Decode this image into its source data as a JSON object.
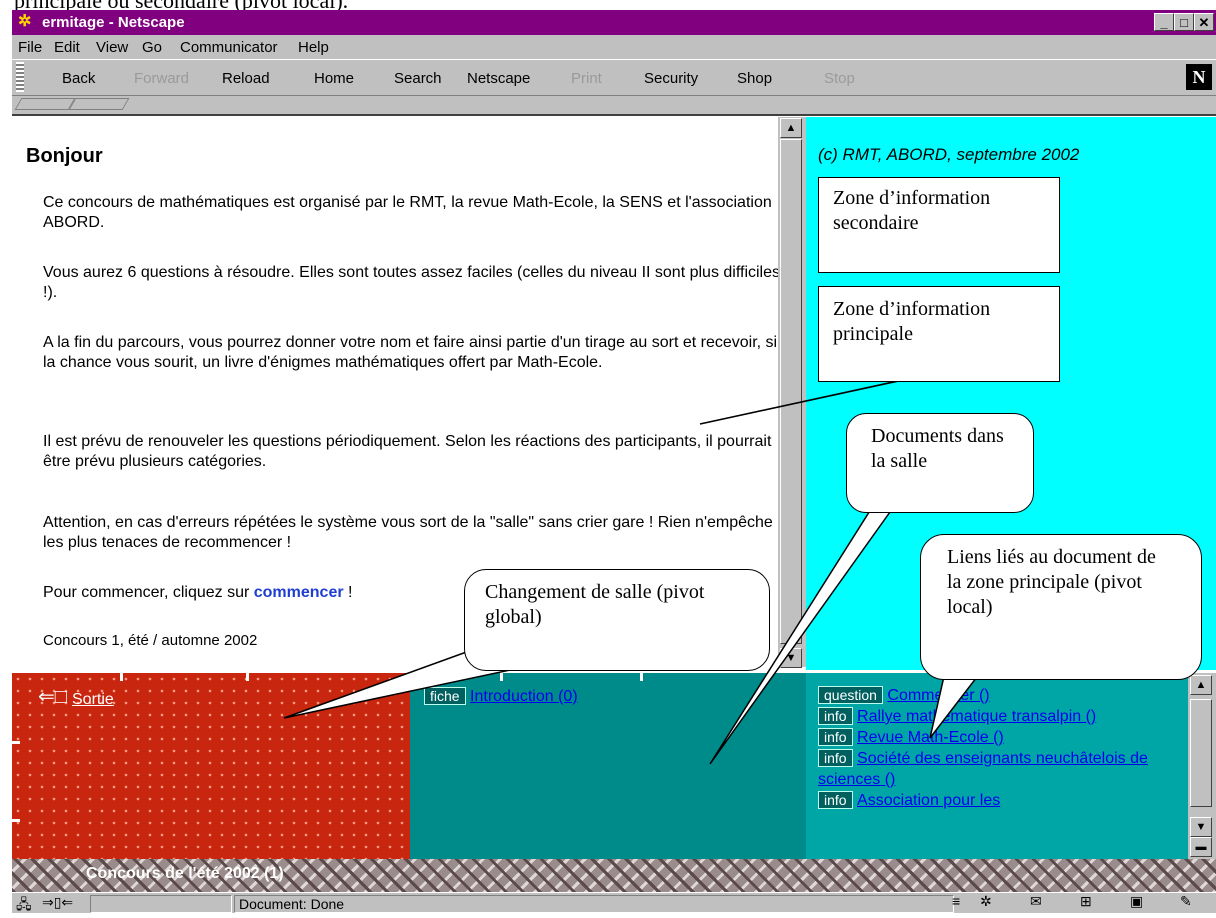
{
  "caption": "principale ou secondaire (pivot local).",
  "window": {
    "title": "ermitage - Netscape",
    "buttons": [
      "_",
      "□",
      "✕"
    ]
  },
  "menu": [
    "File",
    "Edit",
    "View",
    "Go",
    "Communicator",
    "Help"
  ],
  "toolbar": [
    {
      "label": "Back",
      "enabled": true
    },
    {
      "label": "Forward",
      "enabled": false
    },
    {
      "label": "Reload",
      "enabled": true
    },
    {
      "label": "Home",
      "enabled": true
    },
    {
      "label": "Search",
      "enabled": true
    },
    {
      "label": "Netscape",
      "enabled": true
    },
    {
      "label": "Print",
      "enabled": false
    },
    {
      "label": "Security",
      "enabled": true
    },
    {
      "label": "Shop",
      "enabled": true
    },
    {
      "label": "Stop",
      "enabled": false
    }
  ],
  "netscape_logo": "N",
  "main": {
    "greeting": "Bonjour",
    "p1": "Ce concours de mathématiques est organisé par le RMT, la revue Math-Ecole, la SENS et l'association ABORD.",
    "p2": "Vous aurez 6 questions à résoudre. Elles sont toutes assez faciles (celles du niveau II sont plus difficiles !).",
    "p3": "A la fin du parcours, vous pourrez donner votre nom et faire ainsi partie d'un tirage au sort et recevoir, si la chance vous sourit, un livre d'énigmes mathématiques offert par Math-Ecole.",
    "p4": "Il est prévu de renouveler les questions périodiquement. Selon les réactions des participants, il pourrait être prévu plusieurs catégories.",
    "p5": "Attention, en cas d'erreurs répétées le système vous sort de la \"salle\" sans crier gare ! Rien n'empêche les plus tenaces de recommencer !",
    "p6_prefix": "Pour commencer, cliquez sur ",
    "p6_link": "commencer",
    "p6_suffix": " !",
    "footer": "Concours 1, été / automne 2002"
  },
  "right": {
    "copyright": "(c) RMT, ABORD, septembre 2002"
  },
  "callouts": {
    "secondary": "Zone d’information secondaire",
    "principal": "Zone d’information principale",
    "documents": "Documents dans la salle",
    "liens": "Liens liés au document de la zone principale (pivot local)",
    "salle": "Changement de salle (pivot global)"
  },
  "exit": {
    "label": "Sortie"
  },
  "documents": [
    {
      "tag": "fiche",
      "label": "Introduction (0)"
    }
  ],
  "links": [
    {
      "tag": "question",
      "label": "Commencer ()"
    },
    {
      "tag": "info",
      "label": "Rallye mathématique transalpin ()"
    },
    {
      "tag": "info",
      "label": "Revue Math-Ecole ()"
    },
    {
      "tag": "info",
      "label": "Société des enseignants neuchâtelois de sciences ()"
    },
    {
      "tag": "info",
      "label": "Association pour les"
    }
  ],
  "bottom_banner": "Concours de l'été 2002 (1)",
  "status": {
    "text": "Document: Done"
  },
  "colors": {
    "title_bar": "#800080",
    "right_frame": "#00ffff",
    "red_frame": "#c8260e",
    "teal_frame": "#008b8b",
    "link_frame": "#00a6a6"
  }
}
